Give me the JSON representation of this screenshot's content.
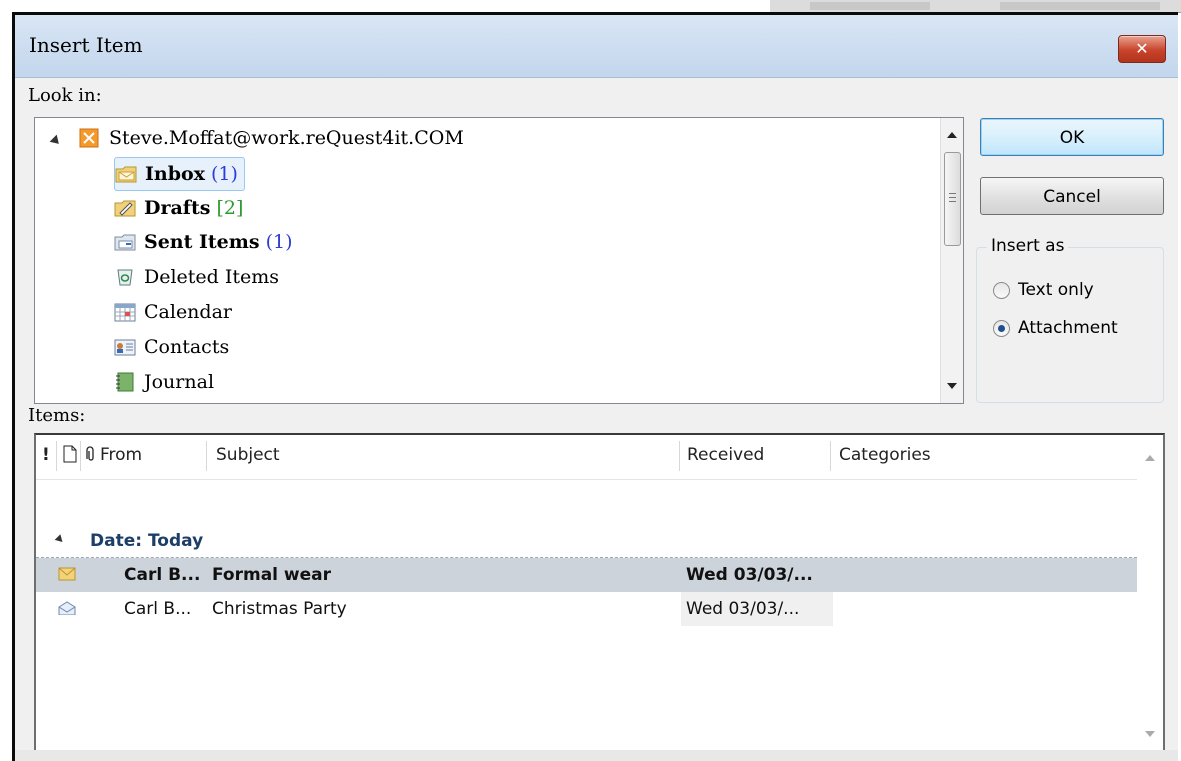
{
  "window": {
    "title": "Insert Item",
    "close_label": "✕"
  },
  "look_in": {
    "label": "Look in:",
    "account": "Steve.Moffat@work.reQuest4it.COM",
    "folders": [
      {
        "name": "Inbox",
        "count": "(1)",
        "count_color": "blue",
        "bold": true,
        "icon": "inbox-folder-icon"
      },
      {
        "name": "Drafts",
        "count": "[2]",
        "count_color": "green",
        "bold": true,
        "icon": "drafts-folder-icon"
      },
      {
        "name": "Sent Items",
        "count": "(1)",
        "count_color": "blue",
        "bold": true,
        "icon": "sent-items-folder-icon"
      },
      {
        "name": "Deleted Items",
        "count": "",
        "bold": false,
        "icon": "recycle-bin-icon"
      },
      {
        "name": "Calendar",
        "count": "",
        "bold": false,
        "icon": "calendar-icon"
      },
      {
        "name": "Contacts",
        "count": "",
        "bold": false,
        "icon": "contacts-icon"
      },
      {
        "name": "Journal",
        "count": "",
        "bold": false,
        "icon": "journal-icon"
      }
    ]
  },
  "buttons": {
    "ok": "OK",
    "cancel": "Cancel"
  },
  "insert_as": {
    "title": "Insert as",
    "options": [
      {
        "label": "Text only",
        "selected": false
      },
      {
        "label": "Attachment",
        "selected": true
      }
    ]
  },
  "items": {
    "label": "Items:",
    "columns": {
      "importance": "!",
      "type": "🗋",
      "attachment": "📎",
      "from": "From",
      "subject": "Subject",
      "received": "Received",
      "categories": "Categories"
    },
    "group": "Date: Today",
    "rows": [
      {
        "from": "Carl B...",
        "subject": "Formal wear",
        "received": "Wed 03/03/...",
        "unread": true,
        "selected": true
      },
      {
        "from": "Carl B...",
        "subject": "Christmas Party",
        "received": "Wed 03/03/...",
        "unread": false,
        "selected": false
      }
    ]
  },
  "colors": {
    "accent": "#3c7fb1",
    "selection": "#cdd3da",
    "group_text": "#1d3e66",
    "count_blue": "#2c3cd6",
    "count_green": "#2e9a2e"
  }
}
